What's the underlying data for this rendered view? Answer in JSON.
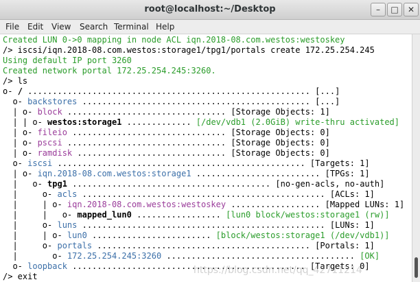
{
  "window": {
    "title": "root@localhost:~/Desktop",
    "btn_min": "–",
    "btn_max": "□",
    "btn_close": "✕"
  },
  "menu": [
    "File",
    "Edit",
    "View",
    "Search",
    "Terminal",
    "Help"
  ],
  "terminal": {
    "lines": [
      [
        {
          "t": "Created LUN 0->0 mapping in node ACL iqn.2018-08.com.westos:westoskey",
          "c": "green"
        }
      ],
      [
        {
          "t": "/> iscsi/iqn.2018-08.com.westos:storage1/tpg1/portals create 172.25.254.245"
        }
      ],
      [
        {
          "t": "Using default IP port 3260",
          "c": "green"
        }
      ],
      [
        {
          "t": "Created network portal 172.25.254.245:3260.",
          "c": "green"
        }
      ],
      [
        {
          "t": "/> ls"
        }
      ],
      [
        {
          "t": "o- "
        },
        {
          "t": "/",
          "c": "bold"
        },
        {
          "t": " ......................................................... [...]"
        }
      ],
      [
        {
          "t": "  o- "
        },
        {
          "t": "backstores",
          "c": "blue"
        },
        {
          "t": " .............................................. [...]"
        }
      ],
      [
        {
          "t": "  | o- "
        },
        {
          "t": "block",
          "c": "magenta"
        },
        {
          "t": " ................................ [Storage Objects: 1]"
        }
      ],
      [
        {
          "t": "  | | o- "
        },
        {
          "t": "westos:storage1",
          "c": "bold"
        },
        {
          "t": " ............. "
        },
        {
          "t": "[/dev/vdb1 (2.0GiB) write-thru activated]",
          "c": "green"
        }
      ],
      [
        {
          "t": "  | o- "
        },
        {
          "t": "fileio",
          "c": "magenta"
        },
        {
          "t": " ............................... [Storage Objects: 0]"
        }
      ],
      [
        {
          "t": "  | o- "
        },
        {
          "t": "pscsi",
          "c": "magenta"
        },
        {
          "t": " ................................ [Storage Objects: 0]"
        }
      ],
      [
        {
          "t": "  | o- "
        },
        {
          "t": "ramdisk",
          "c": "magenta"
        },
        {
          "t": " .............................. [Storage Objects: 0]"
        }
      ],
      [
        {
          "t": "  o- "
        },
        {
          "t": "iscsi",
          "c": "blue"
        },
        {
          "t": " .................................................. [Targets: 1]"
        }
      ],
      [
        {
          "t": "  | o- "
        },
        {
          "t": "iqn.2018-08.com.westos:storage1",
          "c": "blue"
        },
        {
          "t": " ......................... [TPGs: 1]"
        }
      ],
      [
        {
          "t": "  |   o- "
        },
        {
          "t": "tpg1",
          "c": "bold"
        },
        {
          "t": " ........................................ [no-gen-acls, no-auth]"
        }
      ],
      [
        {
          "t": "  |     o- "
        },
        {
          "t": "acls",
          "c": "blue"
        },
        {
          "t": " ................................................. [ACLs: 1]"
        }
      ],
      [
        {
          "t": "  |     | o- "
        },
        {
          "t": "iqn.2018-08.com.westos:westoskey",
          "c": "magenta"
        },
        {
          "t": " .................. [Mapped LUNs: 1]"
        }
      ],
      [
        {
          "t": "  |     |   o- "
        },
        {
          "t": "mapped_lun0",
          "c": "bold"
        },
        {
          "t": " ................. "
        },
        {
          "t": "[lun0 block/westos:storage1 (rw)]",
          "c": "green"
        }
      ],
      [
        {
          "t": "  |     o- "
        },
        {
          "t": "luns",
          "c": "blue"
        },
        {
          "t": " ................................................. [LUNs: 1]"
        }
      ],
      [
        {
          "t": "  |     | o- "
        },
        {
          "t": "lun0",
          "c": "blue"
        },
        {
          "t": " ........................ "
        },
        {
          "t": "[block/westos:storage1 (/dev/vdb1)]",
          "c": "green"
        }
      ],
      [
        {
          "t": "  |     o- "
        },
        {
          "t": "portals",
          "c": "blue"
        },
        {
          "t": " ........................................... [Portals: 1]"
        }
      ],
      [
        {
          "t": "  |       o- "
        },
        {
          "t": "172.25.254.245:3260",
          "c": "blue"
        },
        {
          "t": " ...................................... "
        },
        {
          "t": "[OK]",
          "c": "green"
        }
      ],
      [
        {
          "t": "  o- "
        },
        {
          "t": "loopback",
          "c": "blue"
        },
        {
          "t": " ............................................... [Targets: 0]"
        }
      ],
      [
        {
          "t": "/> exit"
        }
      ]
    ]
  },
  "watermark": "https://blog.csdn.net/qq_42711214"
}
